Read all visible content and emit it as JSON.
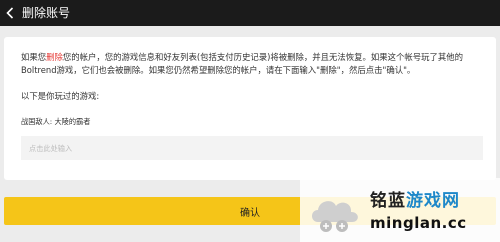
{
  "header": {
    "title": "删除账号",
    "back_icon": "chevron-left-icon"
  },
  "notice": {
    "part1": "如果您",
    "highlight": "删除",
    "part2": "您的帐户，您的游戏信息和好友列表(包括支付历史记录)将被删除，并且无法恢复。如果这个帐号玩了其他的Boltrend游戏，它们也会被删除。如果您仍然希望删除您的帐户，请在下面输入\"删除\"，然后点击\"确认\"。"
  },
  "games": {
    "heading": "以下是你玩过的游戏:",
    "items": [
      "战国敌人: 大陵的霸者"
    ]
  },
  "input": {
    "placeholder": "点击此处输入",
    "value": ""
  },
  "confirm_button": {
    "label": "确认"
  },
  "watermark": {
    "brand_part1": "铭蓝",
    "brand_part2": "游戏网",
    "domain": "minglan.cc"
  },
  "colors": {
    "header_bg": "#1b1b1b",
    "accent_yellow": "#f5c518",
    "highlight_red": "#e53935",
    "page_bg": "#ececec"
  }
}
